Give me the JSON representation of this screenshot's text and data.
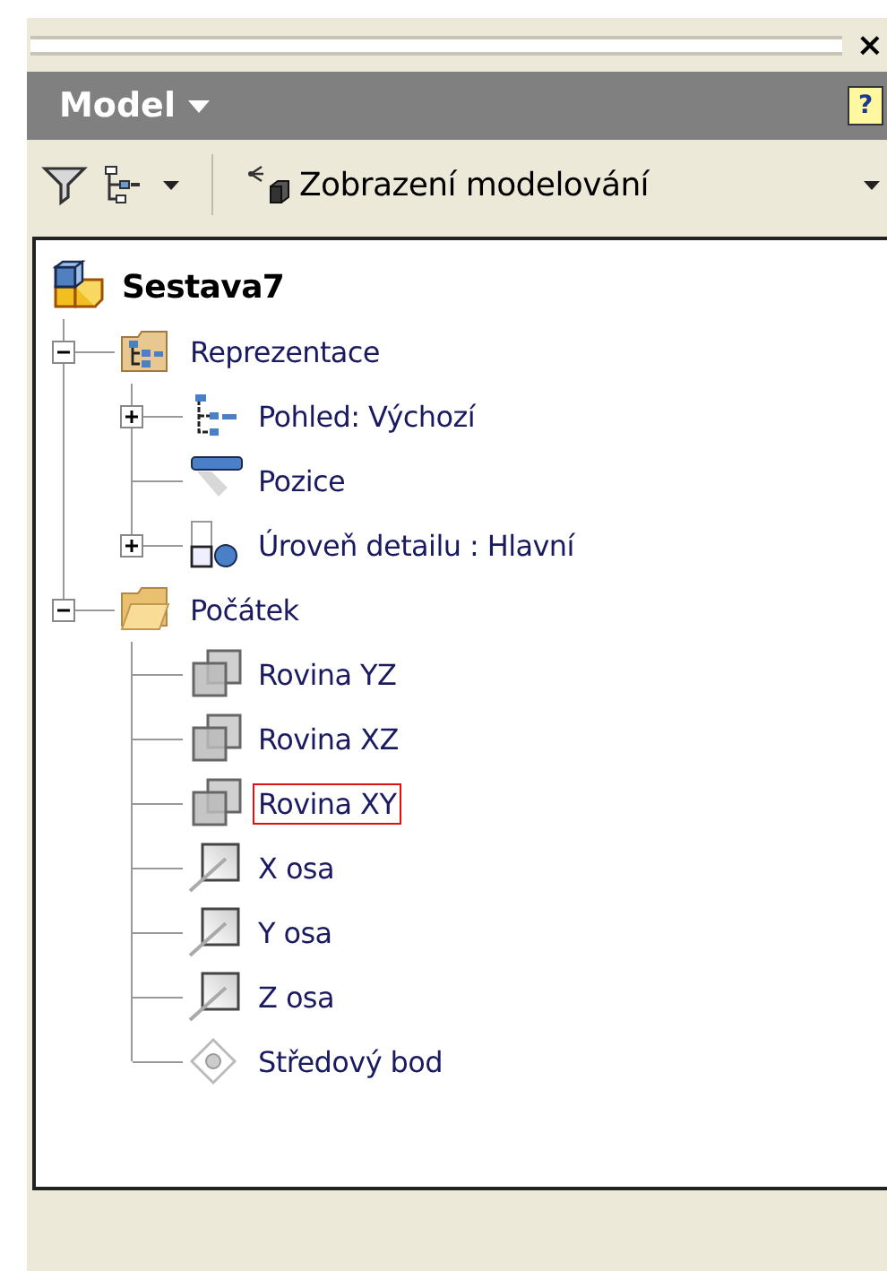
{
  "panel": {
    "close": "×"
  },
  "header": {
    "title": "Model",
    "help": "?"
  },
  "toolbar": {
    "view_label": "Zobrazení modelování"
  },
  "tree": {
    "root": {
      "label": "Sestava7",
      "kind": "assembly",
      "children": [
        {
          "label": "Reprezentace",
          "kind": "rep-folder",
          "expanded": true,
          "highlighted": false,
          "children": [
            {
              "label": "Pohled: Výchozí",
              "kind": "view",
              "expanded": false,
              "highlighted": false
            },
            {
              "label": "Pozice",
              "kind": "position",
              "highlighted": false
            },
            {
              "label": "Úroveň detailu : Hlavní",
              "kind": "lod",
              "expanded": false,
              "highlighted": false
            }
          ]
        },
        {
          "label": "Počátek",
          "kind": "folder",
          "expanded": true,
          "highlighted": false,
          "children": [
            {
              "label": "Rovina YZ",
              "kind": "plane",
              "highlighted": false
            },
            {
              "label": "Rovina XZ",
              "kind": "plane",
              "highlighted": false
            },
            {
              "label": "Rovina XY",
              "kind": "plane",
              "highlighted": true
            },
            {
              "label": "X osa",
              "kind": "axis",
              "highlighted": false
            },
            {
              "label": "Y osa",
              "kind": "axis",
              "highlighted": false
            },
            {
              "label": "Z osa",
              "kind": "axis",
              "highlighted": false
            },
            {
              "label": "Středový bod",
              "kind": "point",
              "highlighted": false
            }
          ]
        }
      ]
    }
  }
}
